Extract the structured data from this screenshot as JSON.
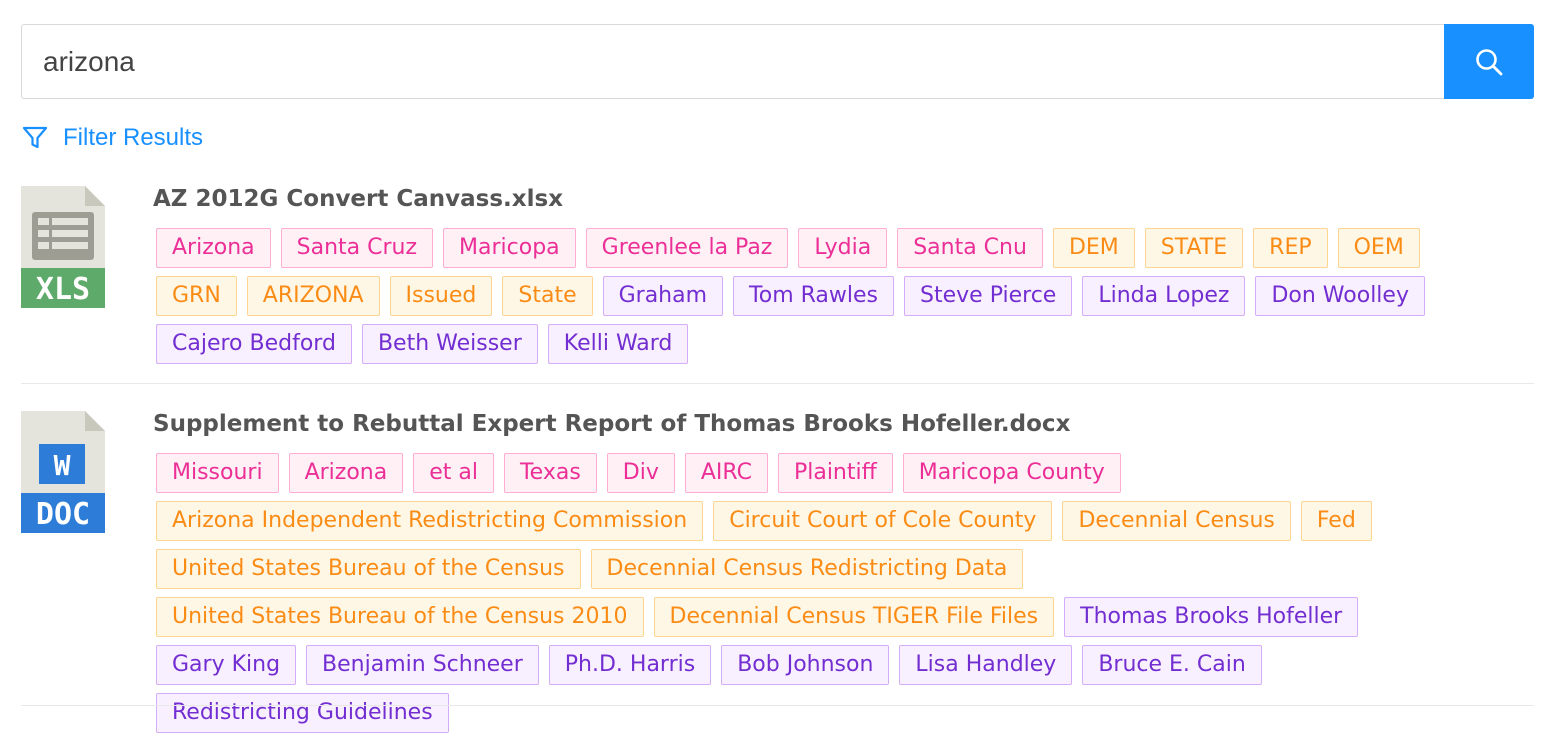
{
  "search": {
    "value": "arizona",
    "placeholder": ""
  },
  "filter": {
    "label": "Filter Results"
  },
  "colors": {
    "accent": "#1890ff",
    "magenta": "#eb2f96",
    "orange": "#fa8c16",
    "purple": "#722ed1"
  },
  "results": [
    {
      "title": "AZ 2012G Convert Canvass.xlsx",
      "icon": "xls-file-icon",
      "icon_label": "XLS",
      "tags": [
        {
          "label": "Arizona",
          "kind": "person-loc"
        },
        {
          "label": "Santa Cruz",
          "kind": "person-loc"
        },
        {
          "label": "Maricopa",
          "kind": "person-loc"
        },
        {
          "label": "Greenlee la Paz",
          "kind": "person-loc"
        },
        {
          "label": "Lydia",
          "kind": "person-loc"
        },
        {
          "label": "Santa Cnu",
          "kind": "person-loc"
        },
        {
          "label": "DEM",
          "kind": "org"
        },
        {
          "label": "STATE",
          "kind": "org"
        },
        {
          "label": "REP",
          "kind": "org"
        },
        {
          "label": "OEM",
          "kind": "org"
        },
        {
          "label": "GRN",
          "kind": "org"
        },
        {
          "label": "ARIZONA",
          "kind": "org"
        },
        {
          "label": "Issued",
          "kind": "org"
        },
        {
          "label": "State",
          "kind": "org"
        },
        {
          "label": "Graham",
          "kind": "person"
        },
        {
          "label": "Tom Rawles",
          "kind": "person"
        },
        {
          "label": "Steve Pierce",
          "kind": "person"
        },
        {
          "label": "Linda Lopez",
          "kind": "person"
        },
        {
          "label": "Don Woolley",
          "kind": "person"
        },
        {
          "label": "Cajero Bedford",
          "kind": "person"
        },
        {
          "label": "Beth Weisser",
          "kind": "person"
        },
        {
          "label": "Kelli Ward",
          "kind": "person"
        }
      ]
    },
    {
      "title": "Supplement to Rebuttal Expert Report of Thomas Brooks Hofeller.docx",
      "icon": "doc-file-icon",
      "icon_label": "DOC",
      "icon_letter": "W",
      "tags": [
        {
          "label": "Missouri",
          "kind": "person-loc"
        },
        {
          "label": "Arizona",
          "kind": "person-loc"
        },
        {
          "label": "et al",
          "kind": "person-loc"
        },
        {
          "label": "Texas",
          "kind": "person-loc"
        },
        {
          "label": "Div",
          "kind": "person-loc"
        },
        {
          "label": "AIRC",
          "kind": "person-loc"
        },
        {
          "label": "Plaintiff",
          "kind": "person-loc"
        },
        {
          "label": "Maricopa County",
          "kind": "person-loc"
        },
        {
          "label": "Arizona Independent Redistricting Commission",
          "kind": "org"
        },
        {
          "label": "Circuit Court of Cole County",
          "kind": "org"
        },
        {
          "label": "Decennial Census",
          "kind": "org"
        },
        {
          "label": "Fed",
          "kind": "org"
        },
        {
          "label": "United States Bureau of the Census",
          "kind": "org"
        },
        {
          "label": "Decennial Census Redistricting Data",
          "kind": "org"
        },
        {
          "label": "United States Bureau of the Census 2010",
          "kind": "org"
        },
        {
          "label": "Decennial Census TIGER File Files",
          "kind": "org"
        },
        {
          "label": "Thomas Brooks Hofeller",
          "kind": "person"
        },
        {
          "label": "Gary King",
          "kind": "person"
        },
        {
          "label": "Benjamin Schneer",
          "kind": "person"
        },
        {
          "label": "Ph.D. Harris",
          "kind": "person"
        },
        {
          "label": "Bob Johnson",
          "kind": "person"
        },
        {
          "label": "Lisa Handley",
          "kind": "person"
        },
        {
          "label": "Bruce E. Cain",
          "kind": "person"
        },
        {
          "label": "Redistricting Guidelines",
          "kind": "person"
        }
      ]
    }
  ]
}
